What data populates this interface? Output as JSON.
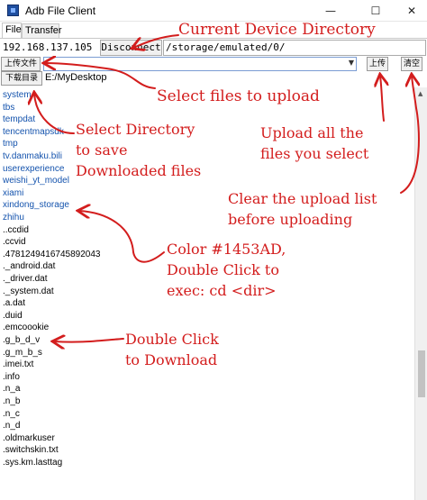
{
  "window": {
    "title": "Adb File Client",
    "minimize_glyph": "—",
    "maximize_glyph": "☐",
    "close_glyph": "✕"
  },
  "tabs": [
    {
      "label": "File",
      "active": true
    },
    {
      "label": "Transfer",
      "active": false
    }
  ],
  "connection": {
    "ip": "192.168.137.105",
    "disconnect_label": "Disconnect",
    "current_path": "/storage/emulated/0/"
  },
  "upload": {
    "select_files_label": "上传文件",
    "file_input_value": "",
    "upload_label": "上传",
    "clear_label": "清空"
  },
  "download": {
    "select_dir_label": "下载目录",
    "dir_path": "E:/MyDesktop"
  },
  "colors": {
    "directory": "#1453AD",
    "annotation": "#d31d1d"
  },
  "files": [
    {
      "name": "system",
      "type": "dir"
    },
    {
      "name": "tbs",
      "type": "dir"
    },
    {
      "name": "tempdat",
      "type": "dir"
    },
    {
      "name": "tencentmapsdk",
      "type": "dir"
    },
    {
      "name": "tmp",
      "type": "dir"
    },
    {
      "name": "tv.danmaku.bili",
      "type": "dir"
    },
    {
      "name": "userexperience",
      "type": "dir"
    },
    {
      "name": "weishi_yt_model",
      "type": "dir"
    },
    {
      "name": "xiami",
      "type": "dir"
    },
    {
      "name": "xindong_storage",
      "type": "dir"
    },
    {
      "name": "zhihu",
      "type": "dir"
    },
    {
      "name": "..ccdid",
      "type": "file"
    },
    {
      "name": ".ccvid",
      "type": "file"
    },
    {
      "name": ".4781249416745892043",
      "type": "file"
    },
    {
      "name": "._android.dat",
      "type": "file"
    },
    {
      "name": "._driver.dat",
      "type": "file"
    },
    {
      "name": "._system.dat",
      "type": "file"
    },
    {
      "name": ".a.dat",
      "type": "file"
    },
    {
      "name": ".duid",
      "type": "file"
    },
    {
      "name": ".emcoookie",
      "type": "file"
    },
    {
      "name": ".g_b_d_v",
      "type": "file"
    },
    {
      "name": ".g_m_b_s",
      "type": "file"
    },
    {
      "name": ".imei.txt",
      "type": "file"
    },
    {
      "name": ".info",
      "type": "file"
    },
    {
      "name": ".n_a",
      "type": "file"
    },
    {
      "name": ".n_b",
      "type": "file"
    },
    {
      "name": ".n_c",
      "type": "file"
    },
    {
      "name": ".n_d",
      "type": "file"
    },
    {
      "name": ".oldmarkuser",
      "type": "file"
    },
    {
      "name": ".switchskin.txt",
      "type": "file"
    },
    {
      "name": ".sys.km.lasttag",
      "type": "file"
    }
  ],
  "annotations": {
    "current_dir": "Current Device Directory",
    "select_files": "Select files to upload",
    "select_dir_1": "Select Directory",
    "select_dir_2": "to save",
    "select_dir_3": "Downloaded files",
    "upload_all_1": "Upload all the",
    "upload_all_2": "files you select",
    "clear_list_1": "Clear the upload list",
    "clear_list_2": "before uploading",
    "color_1": "Color #1453AD,",
    "color_2": "Double Click to",
    "color_3": "exec: cd <dir>",
    "double_click_1": "Double Click",
    "double_click_2": "to Download"
  }
}
